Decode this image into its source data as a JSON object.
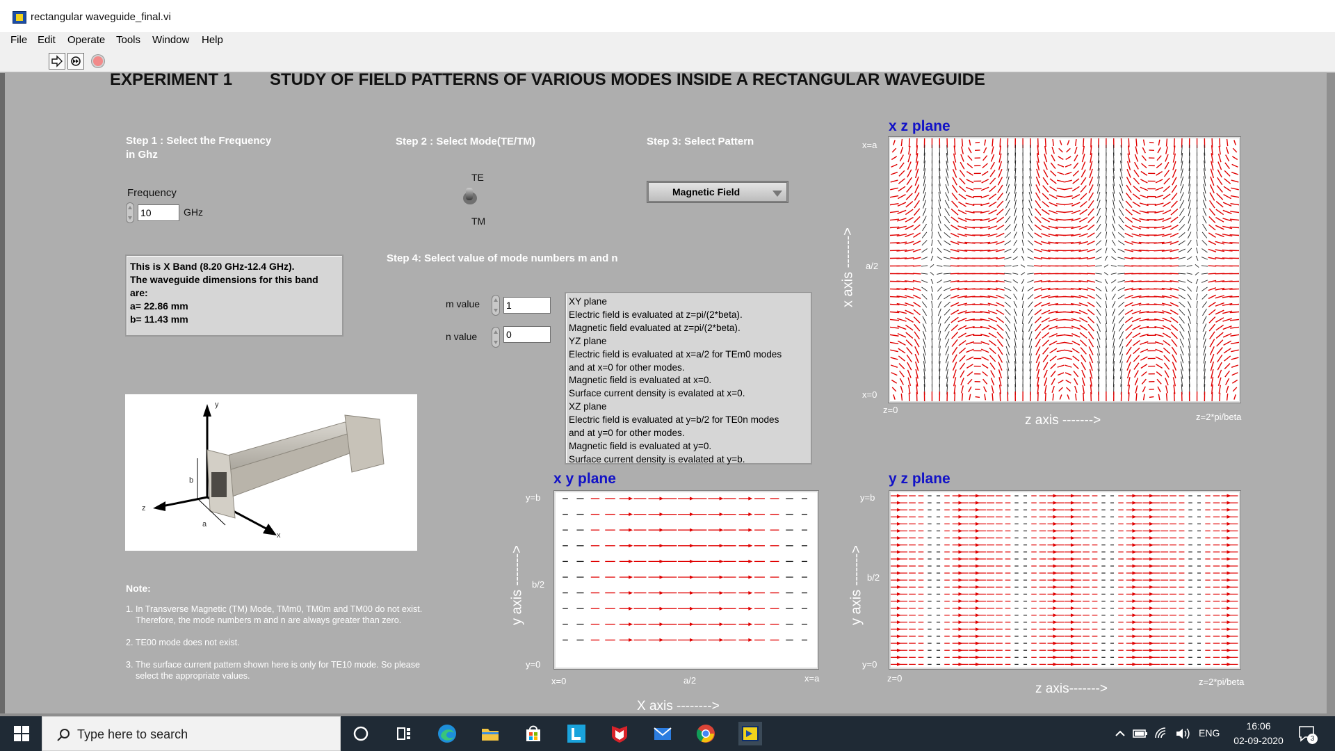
{
  "window": {
    "title": "rectangular waveguide_final.vi",
    "menu": [
      "File",
      "Edit",
      "Operate",
      "Tools",
      "Window",
      "Help"
    ]
  },
  "header": {
    "experiment": "EXPERIMENT 1",
    "title": "STUDY OF FIELD PATTERNS OF VARIOUS MODES INSIDE A RECTANGULAR WAVEGUIDE"
  },
  "step1": {
    "label_line1": "Step 1 : Select the Frequency",
    "label_line2": "in Ghz",
    "control_label": "Frequency",
    "value": "10",
    "unit": "GHz"
  },
  "step2": {
    "label": "Step 2 : Select Mode(TE/TM)",
    "option_top": "TE",
    "option_bottom": "TM"
  },
  "step3": {
    "label": "Step 3: Select Pattern",
    "selected": "Magnetic Field"
  },
  "step4": {
    "label": "Step 4: Select value of mode numbers m and n",
    "m_label": "m value",
    "m_value": "1",
    "n_label": "n value",
    "n_value": "0"
  },
  "band_info": {
    "lines": [
      "This is X Band (8.20 GHz-12.4 GHz).",
      "The waveguide dimensions for this band",
      "are:",
      "a= 22.86 mm",
      "b= 11.43 mm"
    ]
  },
  "evaluation_notes": [
    "XY plane",
    "Electric field is evaluated at z=pi/(2*beta).",
    "Magnetic field evaluated at z=pi/(2*beta).",
    "YZ plane",
    "Electric field is evaluated at x=a/2  for TEm0 modes",
    "and at x=0 for other modes.",
    "Magnetic field is evaluated at x=0.",
    "Surface current density is evalated at x=0.",
    "XZ plane",
    "Electric field is evaluated at y=b/2  for TE0n modes",
    "and at y=0 for other modes.",
    "Magnetic field is evaluated at y=0.",
    "Surface current density is evalated at y=b."
  ],
  "diagram_labels": {
    "y": "y",
    "z": "z",
    "x": "x",
    "a": "a",
    "b": "b"
  },
  "notes": {
    "heading": "Note:",
    "items": [
      "1. In Transverse Magnetic (TM) Mode, TMm0, TM0m and TM00 do not exist.",
      "    Therefore, the mode numbers m and n are always greater than zero.",
      "2. TE00 mode does not exist.",
      "3. The surface current pattern shown here is only for TE10 mode. So please",
      "    select the appropriate values."
    ]
  },
  "plots": {
    "xz": {
      "title": "x z plane",
      "y_top": "x=a",
      "y_mid": "a/2",
      "y_bottom": "x=0",
      "x_left": "z=0",
      "x_right": "z=2*pi/beta",
      "x_axis": "z axis  ------->",
      "y_axis": "x axis  ------->"
    },
    "xy": {
      "title": "x y plane",
      "y_top": "y=b",
      "y_mid": "b/2",
      "y_bottom": "y=0",
      "x_left": "x=0",
      "x_mid": "a/2",
      "x_right": "x=a",
      "x_axis": "X axis  -------->",
      "y_axis": "y axis  ------->"
    },
    "yz": {
      "title": "y z plane",
      "y_top": "y=b",
      "y_mid": "b/2",
      "y_bottom": "y=0",
      "x_left": "z=0",
      "x_right": "z=2*pi/beta",
      "x_axis": "z axis------->",
      "y_axis": "y axis  ------->"
    }
  },
  "taskbar": {
    "search_placeholder": "Type here to search",
    "language": "ENG",
    "time": "16:06",
    "date": "02-09-2020",
    "notification_count": "3",
    "pinned": [
      "cortana-icon",
      "task-view-icon",
      "edge-icon",
      "file-explorer-icon",
      "store-icon",
      "l-app-icon",
      "mcafee-icon",
      "mail-icon",
      "chrome-icon",
      "labview-icon"
    ]
  },
  "colors": {
    "panel": "#aeaeae",
    "plane_title": "#1212c7",
    "field_arrow": "#e00000",
    "taskbar": "#1f2a35"
  }
}
